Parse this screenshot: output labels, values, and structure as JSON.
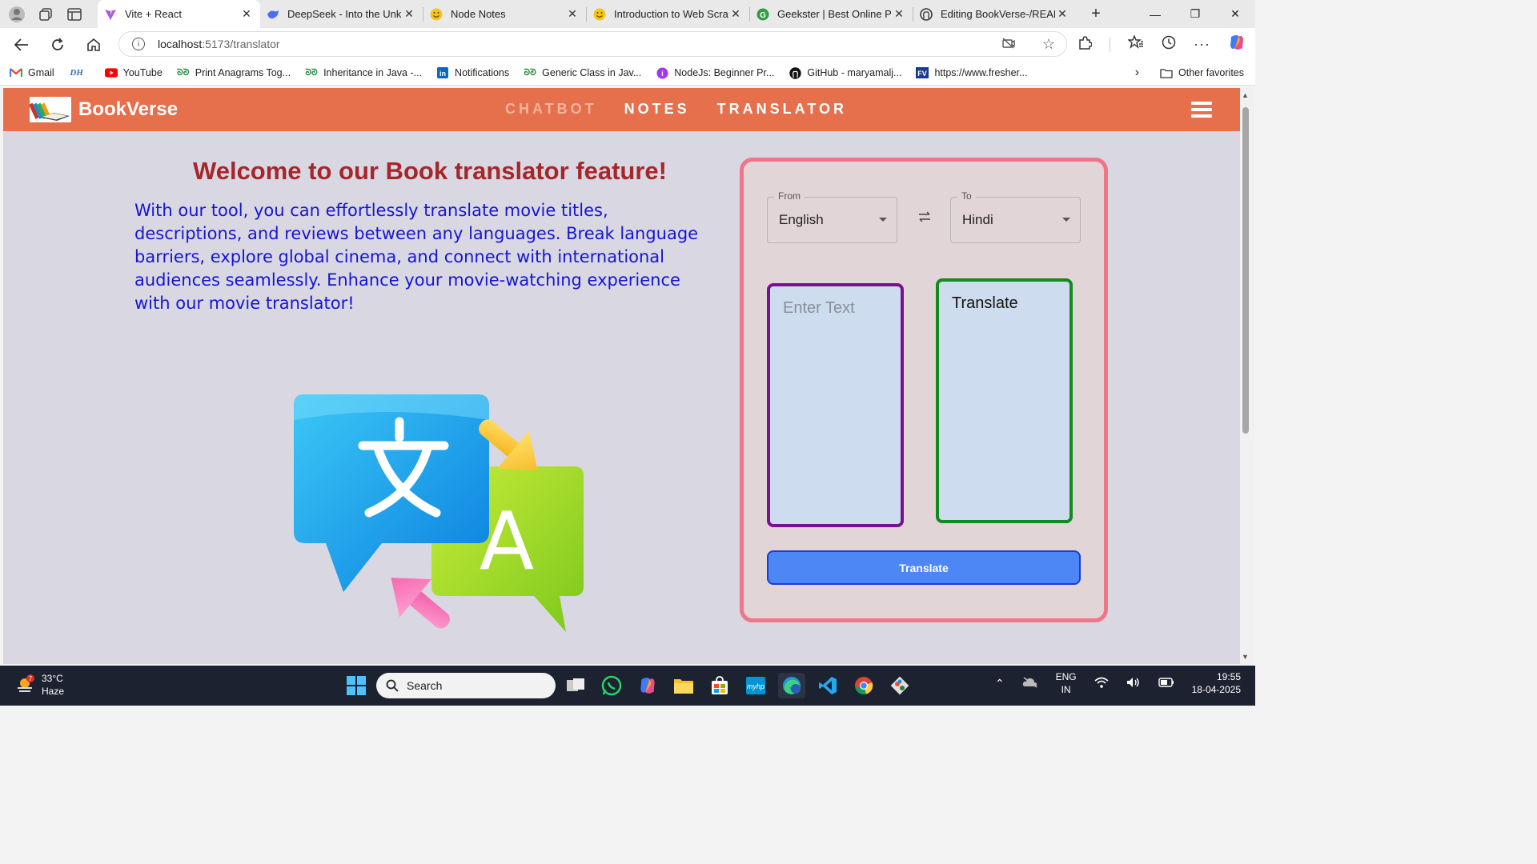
{
  "browser": {
    "tabs": [
      {
        "title": "Vite + React",
        "active": true,
        "icon": "vite-icon",
        "color": "#a259ff"
      },
      {
        "title": "DeepSeek - Into the Unkn",
        "active": false,
        "icon": "deepseek-icon",
        "color": "#4d6bfe"
      },
      {
        "title": "Node Notes",
        "active": false,
        "icon": "smiley-icon",
        "color": "#f5c518"
      },
      {
        "title": "Introduction to Web Scrap",
        "active": false,
        "icon": "smiley-icon",
        "color": "#f5c518"
      },
      {
        "title": "Geekster | Best Online Pla",
        "active": false,
        "icon": "geekster-icon",
        "color": "#2e9e44"
      },
      {
        "title": "Editing BookVerse-/READI",
        "active": false,
        "icon": "github-icon",
        "color": "#333333"
      }
    ],
    "url_host": "localhost",
    "url_path": ":5173/translator",
    "bookmarks": [
      {
        "label": "Gmail",
        "icon": "gmail-icon"
      },
      {
        "label": "",
        "icon": "dh-icon",
        "text": "DH"
      },
      {
        "label": "YouTube",
        "icon": "youtube-icon"
      },
      {
        "label": "Print Anagrams Tog...",
        "icon": "gfg-icon"
      },
      {
        "label": "Inheritance in Java -...",
        "icon": "gfg-icon"
      },
      {
        "label": "Notifications",
        "icon": "linkedin-icon"
      },
      {
        "label": "Generic Class in Jav...",
        "icon": "gfg-icon"
      },
      {
        "label": "NodeJs: Beginner Pr...",
        "icon": "udemy-icon"
      },
      {
        "label": "GitHub - maryamalj...",
        "icon": "github-icon"
      },
      {
        "label": "https://www.fresher...",
        "icon": "fv-icon"
      }
    ],
    "other_favorites": "Other favorites"
  },
  "app": {
    "brand": "BookVerse",
    "nav": [
      "CHATBOT",
      "NOTES",
      "TRANSLATOR"
    ],
    "welcome": "Welcome to our Book translator feature!",
    "description": "With our tool, you can effortlessly translate movie titles, descriptions, and reviews between any languages. Break language barriers, explore global cinema, and connect with international audiences seamlessly. Enhance your movie-watching experience with our movie translator!",
    "from_label": "From",
    "from_value": "English",
    "to_label": "To",
    "to_value": "Hindi",
    "input_placeholder": "Enter Text",
    "output_text": "Translate",
    "button_label": "Translate",
    "colors": {
      "nav": "#e66f4c",
      "heading": "#a6262a",
      "body_text": "#1515d4",
      "panel_border": "#f0758a",
      "button": "#4d86f5"
    }
  },
  "taskbar": {
    "weather_temp": "33°C",
    "weather_desc": "Haze",
    "weather_badge": "7",
    "search_label": "Search",
    "lang_top": "ENG",
    "lang_bottom": "IN",
    "time": "19:55",
    "date": "18-04-2025"
  }
}
